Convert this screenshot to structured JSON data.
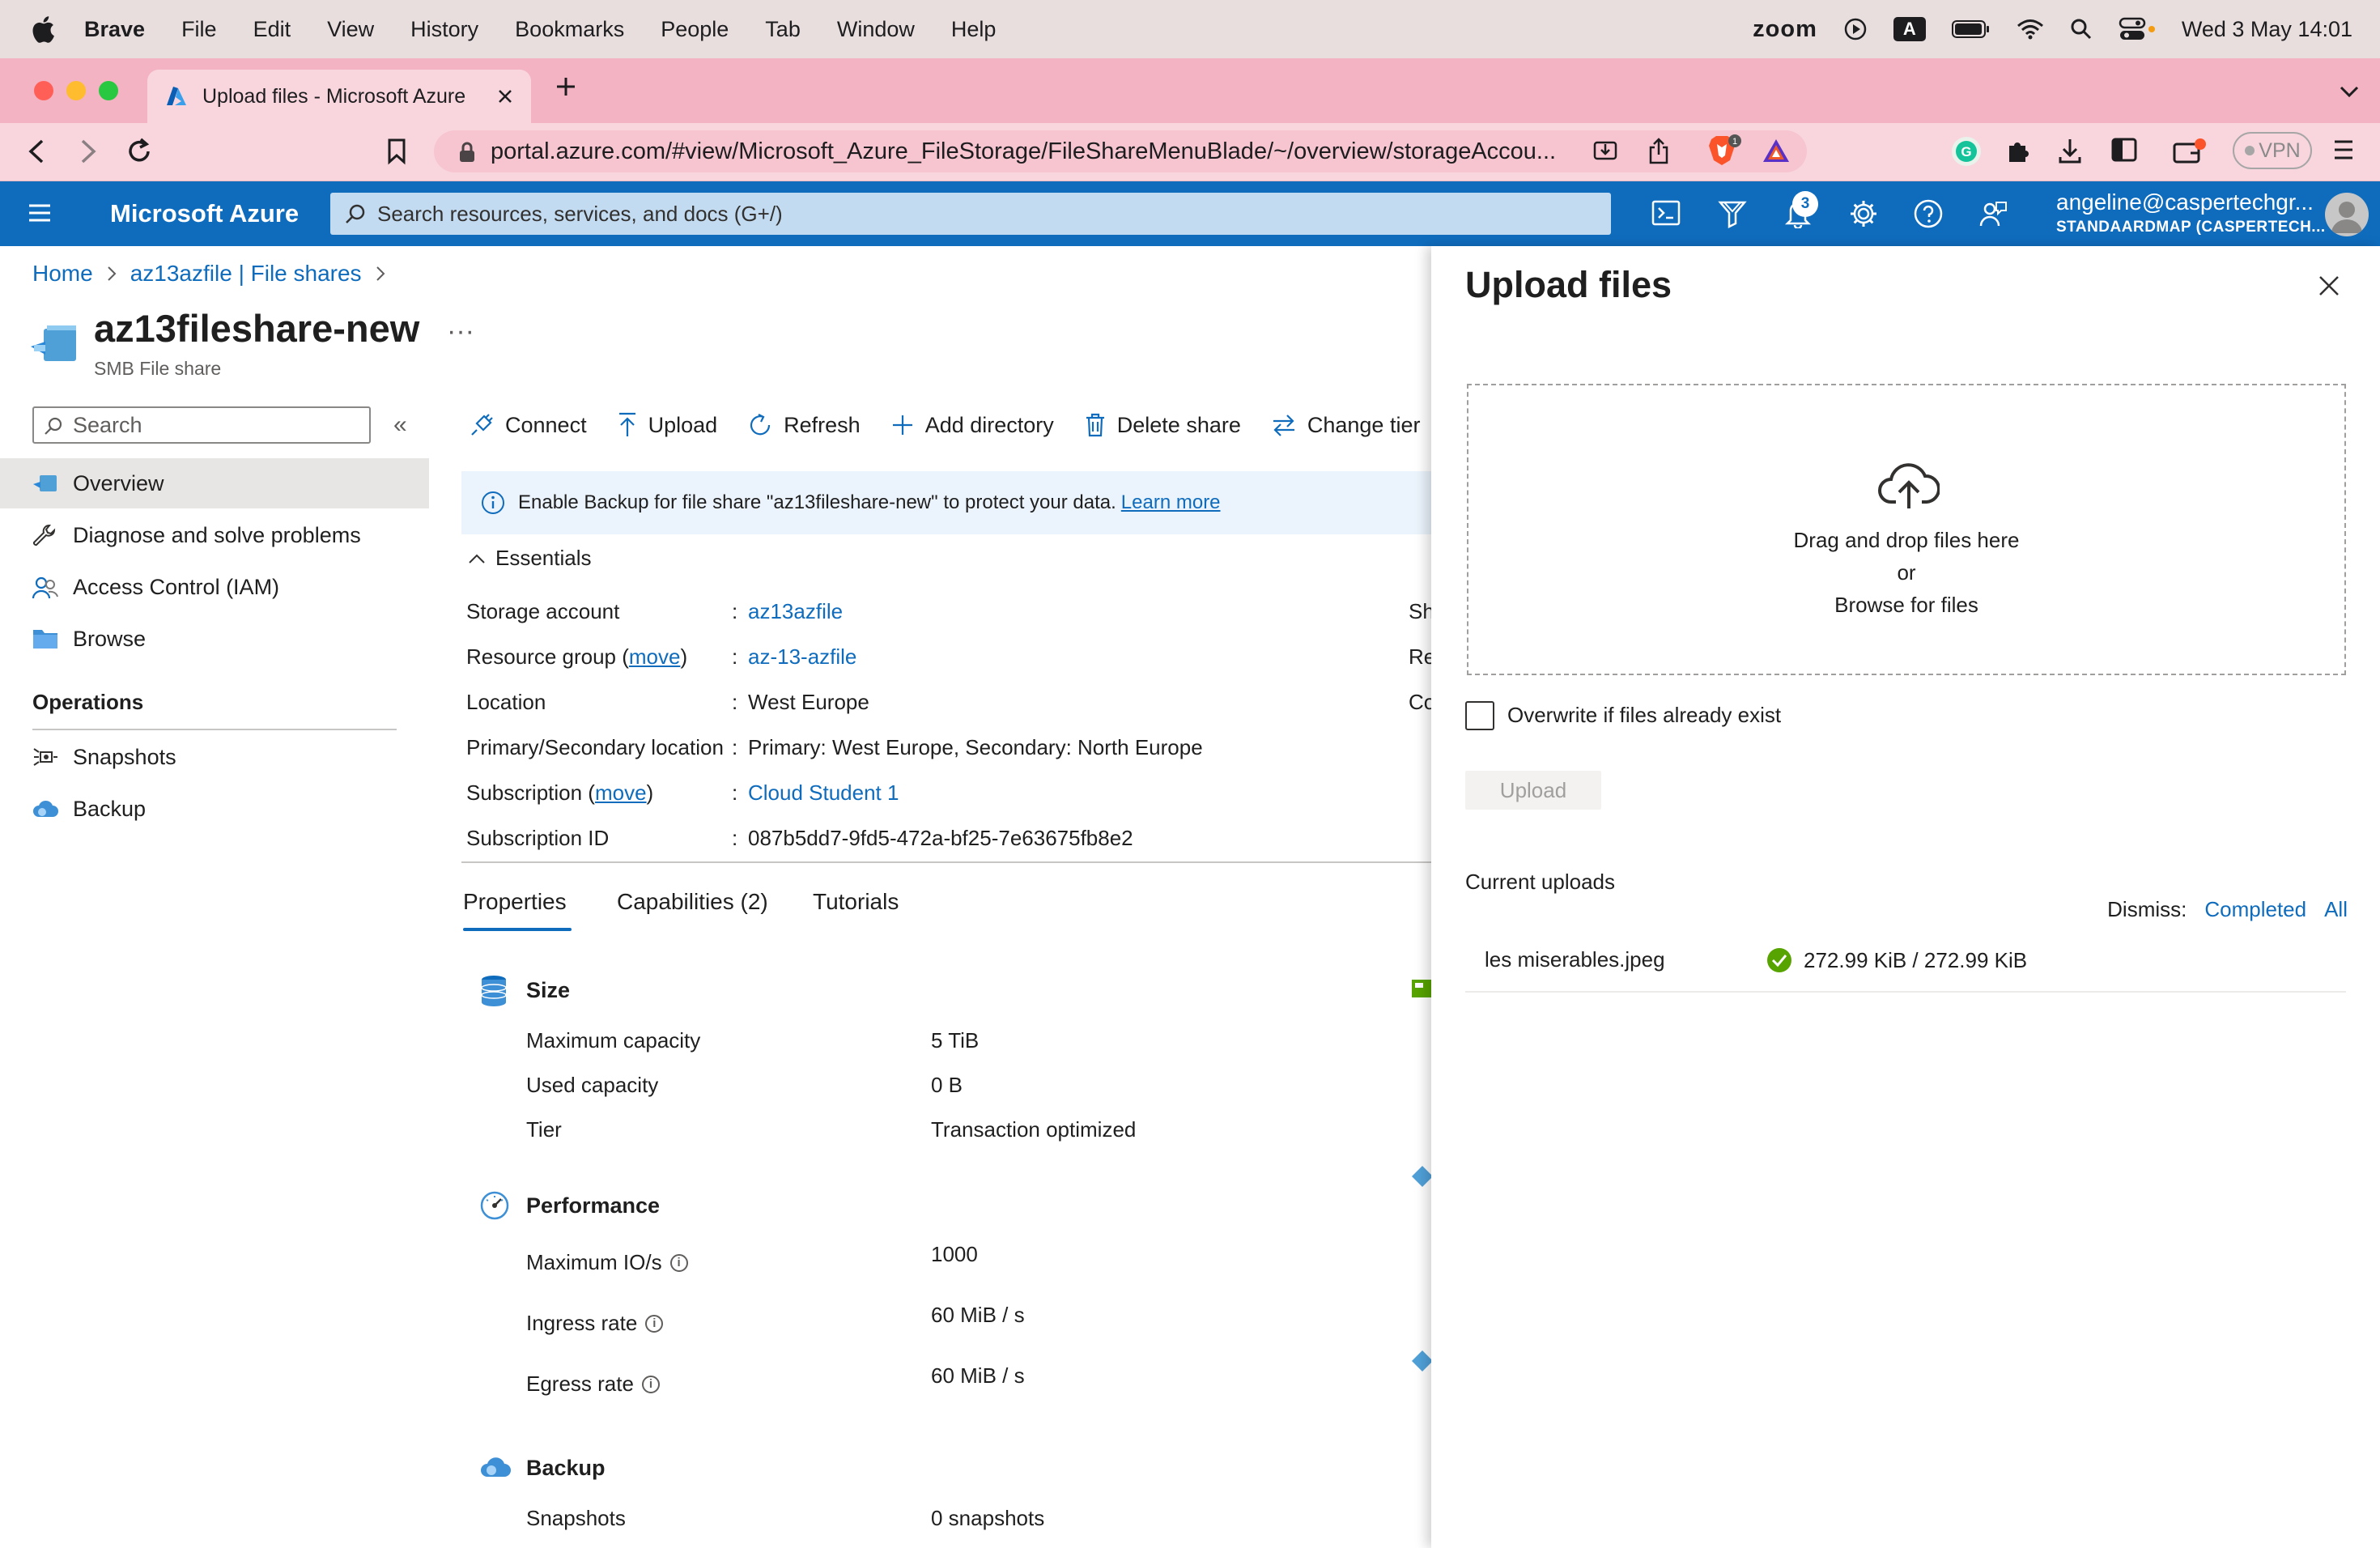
{
  "menubar": {
    "app_name": "Brave",
    "menus": [
      "File",
      "Edit",
      "View",
      "History",
      "Bookmarks",
      "People",
      "Tab",
      "Window",
      "Help"
    ],
    "zoom": "zoom",
    "input_source": "A",
    "datetime": "Wed 3 May  14:01"
  },
  "browser": {
    "tab_title": "Upload files - Microsoft Azure",
    "url": "portal.azure.com/#view/Microsoft_Azure_FileStorage/FileShareMenuBlade/~/overview/storageAccou...",
    "brave_badge": "1",
    "vpn": "VPN"
  },
  "azure": {
    "brand": "Microsoft Azure",
    "search_placeholder": "Search resources, services, and docs (G+/)",
    "notifications": "3",
    "account_email": "angeline@caspertechgr...",
    "account_dir": "STANDAARDMAP (CASPERTECH..."
  },
  "breadcrumb": {
    "home": "Home",
    "parent": "az13azfile | File shares"
  },
  "resource": {
    "title": "az13fileshare-new",
    "subtitle": "SMB File share",
    "more": "···"
  },
  "nav": {
    "search_placeholder": "Search",
    "collapse": "«",
    "items": [
      "Overview",
      "Diagnose and solve problems",
      "Access Control (IAM)",
      "Browse"
    ],
    "operations_heading": "Operations",
    "operations": [
      "Snapshots",
      "Backup"
    ]
  },
  "commands": [
    "Connect",
    "Upload",
    "Refresh",
    "Add directory",
    "Delete share",
    "Change tier"
  ],
  "banner": {
    "text": "Enable Backup for file share \"az13fileshare-new\" to protect your data.",
    "link": "Learn more"
  },
  "essentials": {
    "toggle": "Essentials",
    "storage_account_label": "Storage account",
    "storage_account": "az13azfile",
    "resource_group_label": "Resource group",
    "move": "move",
    "resource_group": "az-13-azfile",
    "location_label": "Location",
    "location": "West Europe",
    "primary_secondary_label": "Primary/Secondary location",
    "primary_secondary": "Primary: West Europe, Secondary: North Europe",
    "subscription_label": "Subscription",
    "subscription": "Cloud Student 1",
    "subscription_id_label": "Subscription ID",
    "subscription_id": "087b5dd7-9fd5-472a-bf25-7e63675fb8e2",
    "right_col": [
      "Sh",
      "Re",
      "Co"
    ]
  },
  "tabs": [
    "Properties",
    "Capabilities (2)",
    "Tutorials"
  ],
  "properties": {
    "size_heading": "Size",
    "max_capacity_label": "Maximum capacity",
    "max_capacity": "5 TiB",
    "used_capacity_label": "Used capacity",
    "used_capacity": "0 B",
    "tier_label": "Tier",
    "tier": "Transaction optimized",
    "performance_heading": "Performance",
    "max_io_label": "Maximum IO/s",
    "max_io": "1000",
    "ingress_label": "Ingress rate",
    "ingress": "60 MiB / s",
    "egress_label": "Egress rate",
    "egress": "60 MiB / s",
    "backup_heading": "Backup",
    "snapshots_label": "Snapshots",
    "snapshots": "0 snapshots"
  },
  "upload_panel": {
    "title": "Upload files",
    "drag_text": "Drag and drop files here",
    "or_text": "or",
    "browse": "Browse for files",
    "overwrite": "Overwrite if files already exist",
    "upload_button": "Upload",
    "current_uploads": "Current uploads",
    "dismiss": "Dismiss:",
    "dismiss_completed": "Completed",
    "dismiss_all": "All",
    "file_name": "les miserables.jpeg",
    "file_progress": "272.99 KiB / 272.99 KiB"
  },
  "colors": {
    "azure_blue": "#0f6cbd",
    "success": "#57a300",
    "tab_pink": "#f3b3c2"
  }
}
